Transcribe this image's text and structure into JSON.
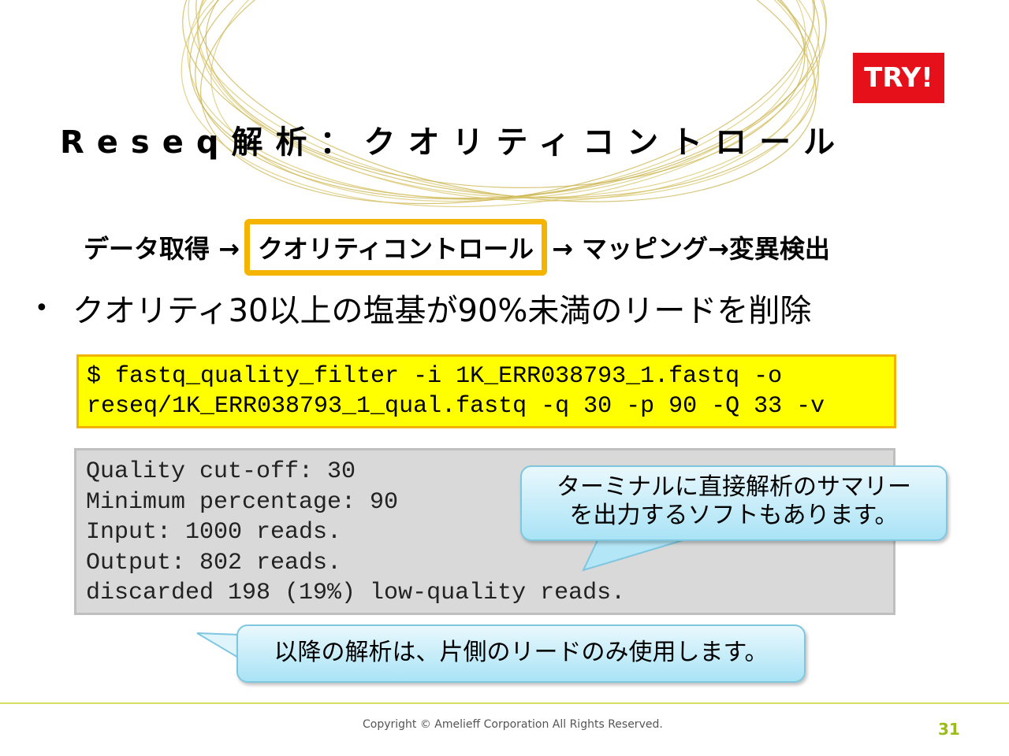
{
  "badge": {
    "label": "TRY!"
  },
  "title": "Reseq解析：クオリティコントロール",
  "flow": {
    "before": "データ取得 → ",
    "highlight": "クオリティコントロール",
    "after": " → マッピング→変異検出"
  },
  "bullet": {
    "marker": "•",
    "text": "クオリティ30以上の塩基が90%未満のリードを削除"
  },
  "command": {
    "lines": [
      "$ fastq_quality_filter -i 1K_ERR038793_1.fastq -o",
      "reseq/1K_ERR038793_1_qual.fastq -q 30 -p 90 -Q 33 -v"
    ]
  },
  "output": {
    "lines": [
      "Quality cut-off: 30",
      "Minimum percentage: 90",
      "Input: 1000 reads.",
      "Output: 802 reads.",
      "discarded 198 (19%) low-quality reads."
    ]
  },
  "callouts": {
    "summary": {
      "line1": "ターミナルに直接解析のサマリー",
      "line2": "を出力するソフトもあります。"
    },
    "note": {
      "text": "以降の解析は、片側のリードのみ使用します。"
    }
  },
  "footer": {
    "copyright": "Copyright © Amelieff Corporation All Rights Reserved.",
    "page_number": "31"
  },
  "colors": {
    "badge": "#e5101a",
    "highlight_border": "#f4b400",
    "command_bg": "#ffff00",
    "output_bg": "#d9d9d9",
    "callout": "#a9e3f6",
    "accent_green": "#9cbc1c"
  }
}
